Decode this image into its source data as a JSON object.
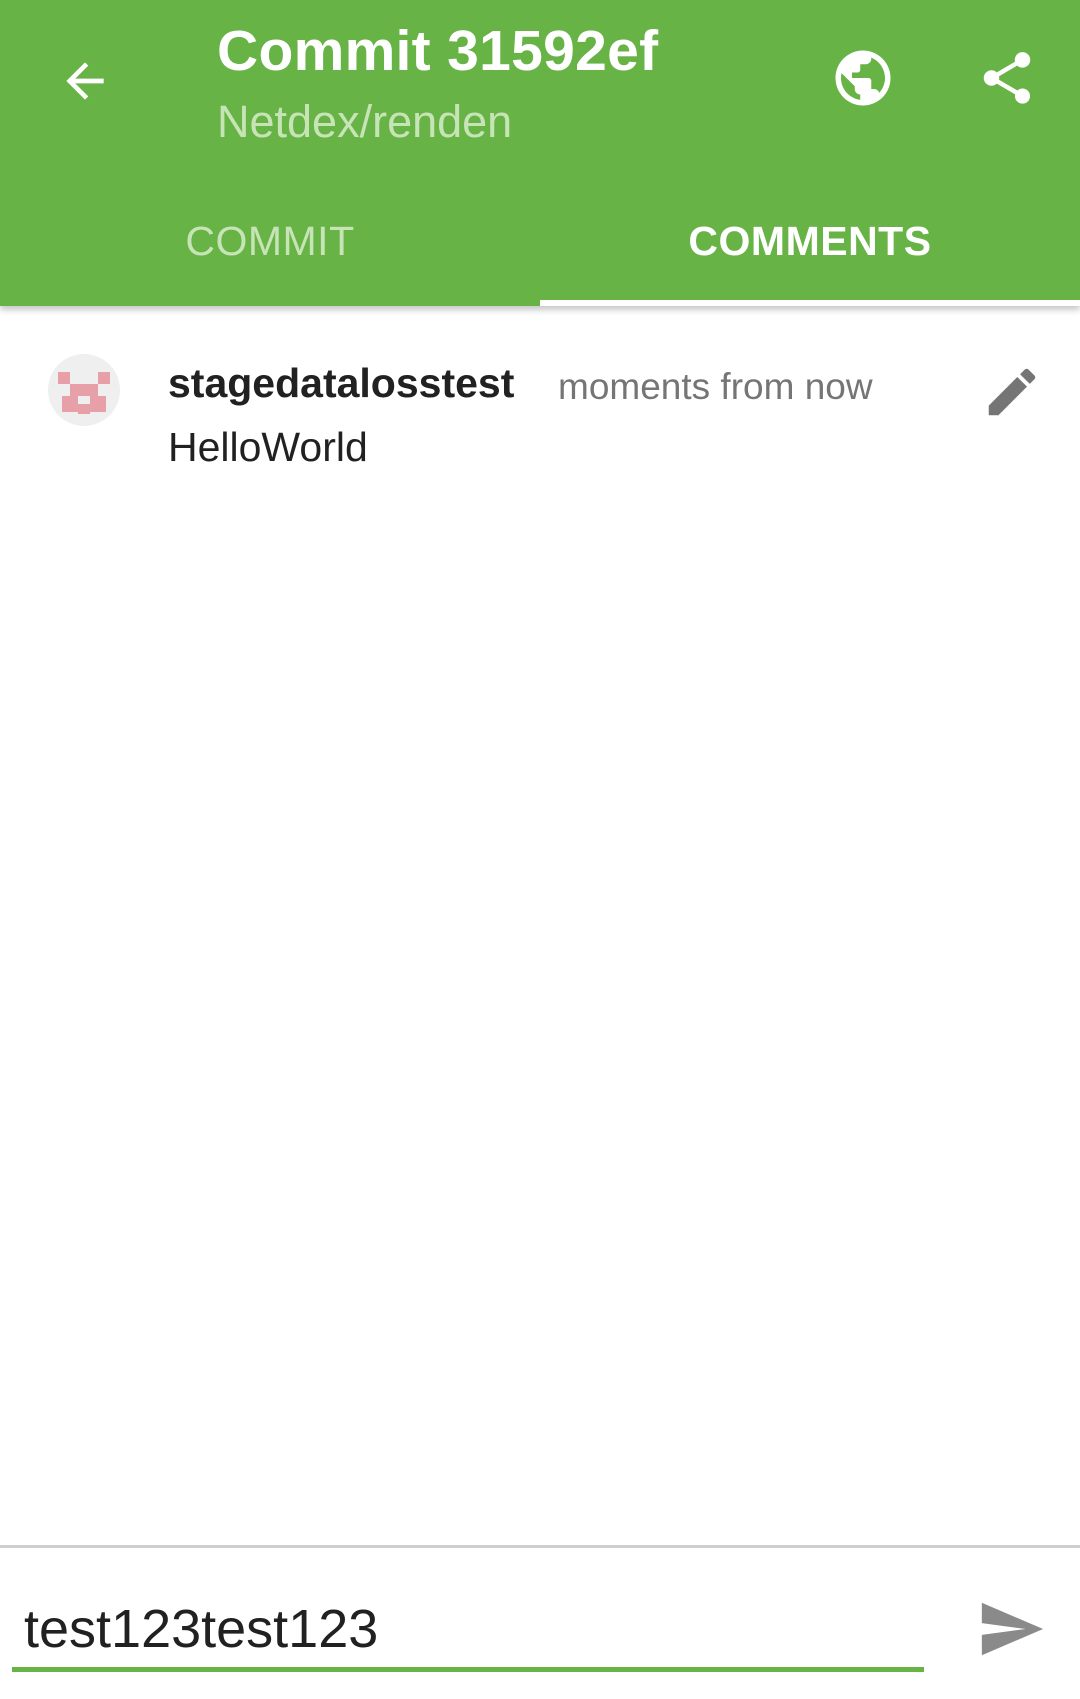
{
  "appbar": {
    "title": "Commit 31592ef",
    "subtitle": "Netdex/renden",
    "background_color": "#67b346",
    "back_icon": "arrow-left-icon",
    "globe_icon": "globe-icon",
    "share_icon": "share-icon"
  },
  "tabs": [
    {
      "label": "COMMIT",
      "active": false
    },
    {
      "label": "COMMENTS",
      "active": true
    }
  ],
  "comments": [
    {
      "author": "stagedatalosstest",
      "timestamp": "moments from now",
      "body": "HelloWorld",
      "avatar_icon": "identicon-avatar",
      "edit_icon": "pencil-icon"
    }
  ],
  "composer": {
    "value": "test123test123",
    "send_icon": "send-icon",
    "accent_color": "#67b346"
  }
}
